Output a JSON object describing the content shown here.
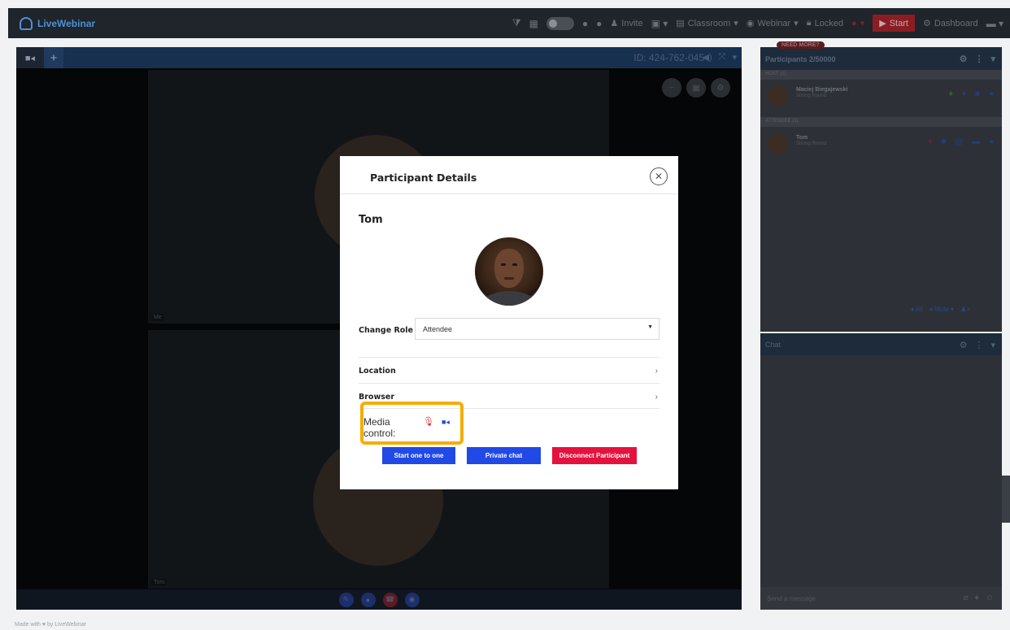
{
  "app": {
    "logo_text": "LiveWebinar"
  },
  "topbar": {
    "invite_label": "Invite",
    "classroom_label": "Classroom",
    "webinar_label": "Webinar",
    "locked_label": "Locked",
    "start_label": "Start",
    "dashboard_label": "Dashboard"
  },
  "video": {
    "room_id": "ID: 424-762-045",
    "tile1_label": "Me",
    "tile2_label": "Tom"
  },
  "participants_panel": {
    "need_more_badge": "NEED MORE?",
    "title": "Participants 2/50000",
    "host_section": "HOST (1)",
    "attendee_section": "ATTENDEE (1)",
    "host": {
      "name": "Maciej Biegajewski",
      "sub": "Strong Round"
    },
    "attendee": {
      "name": "Tom",
      "sub": "Strong Round"
    },
    "footer_all": "All",
    "footer_mute": "Mute"
  },
  "chat_panel": {
    "title": "Chat",
    "input_placeholder": "Send a message"
  },
  "footer": {
    "text": "Made with ♥ by LiveWebinar"
  },
  "modal": {
    "title": "Participant Details",
    "participant_name": "Tom",
    "change_role_label": "Change Role",
    "role_value": "Attendee",
    "location_label": "Location",
    "browser_label": "Browser",
    "media_control_label": "Media control:",
    "start_one_to_one": "Start one to one",
    "private_chat": "Private chat",
    "disconnect": "Disconnect Participant"
  },
  "colors": {
    "primary_button": "#2149e6",
    "danger_button": "#e5123d",
    "highlight_border": "#f5ad00",
    "mic_icon": "#e3343a",
    "camera_icon": "#2449d8"
  },
  "icons": {
    "close": "close-circle-icon",
    "mic": "microphone-icon",
    "camera": "video-camera-icon",
    "chevron": "chevron-right-icon",
    "caret": "caret-down-icon"
  }
}
